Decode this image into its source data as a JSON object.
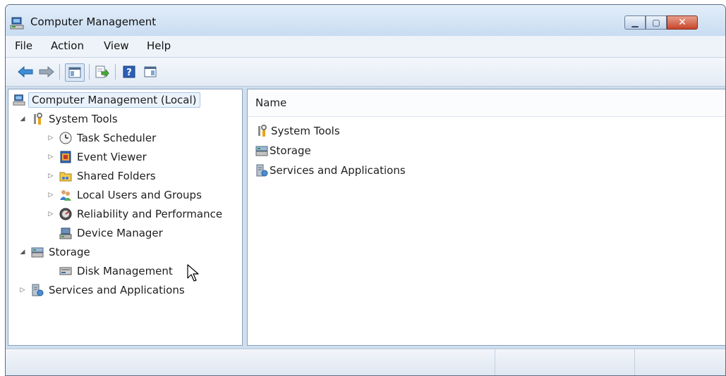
{
  "window": {
    "title": "Computer Management",
    "controls": [
      "minimize",
      "maximize",
      "close"
    ]
  },
  "menu": [
    "File",
    "Action",
    "View",
    "Help"
  ],
  "toolbar": {
    "buttons": [
      "back-icon",
      "forward-icon",
      "show-hide-console-tree-icon",
      "export-list-icon",
      "help-icon",
      "show-hide-action-pane-icon"
    ]
  },
  "tree": {
    "root": "Computer Management (Local)",
    "system_tools": "System Tools",
    "task_scheduler": "Task Scheduler",
    "event_viewer": "Event Viewer",
    "shared_folders": "Shared Folders",
    "local_users": "Local Users and Groups",
    "reliability": "Reliability and Performance",
    "device_manager": "Device Manager",
    "storage": "Storage",
    "disk_management": "Disk Management",
    "services": "Services and Applications"
  },
  "list": {
    "column_name": "Name",
    "items": [
      "System Tools",
      "Storage",
      "Services and Applications"
    ]
  },
  "colors": {
    "selection_border": "#a8c7e8",
    "selection_fill": "#eaf3fc",
    "close_button": "#c8452b",
    "frame": "#cfdfef"
  }
}
